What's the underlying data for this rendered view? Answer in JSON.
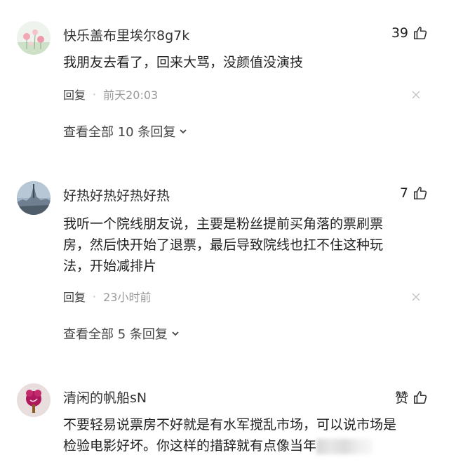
{
  "comments": [
    {
      "username": "快乐盖布里埃尔8g7k",
      "likes": "39",
      "text": "我朋友去看了，回来大骂，没颜值没演技",
      "reply_label": "回复",
      "time": "前天20:03",
      "view_all": "查看全部 10 条回复"
    },
    {
      "username": "好热好热好热好热",
      "likes": "7",
      "text_lines": [
        "我听一个院线朋友说，主要是粉丝提前买角落的票刷票",
        "房，然后快开始了退票，最后导致院线也扛不住这种玩",
        "法，开始减排片"
      ],
      "reply_label": "回复",
      "time": "23小时前",
      "view_all": "查看全部 5 条回复"
    },
    {
      "username": "清闲的帆船sN",
      "likes": "赞",
      "text_lines": [
        "不要轻易说票房不好就是有水军搅乱市场，可以说市场是",
        "检验电影好坏。你这样的措辞就有点像当年"
      ]
    }
  ],
  "icons": {
    "like": "thumbs-up-icon",
    "close": "close-icon",
    "expand": "chevron-down-icon"
  }
}
